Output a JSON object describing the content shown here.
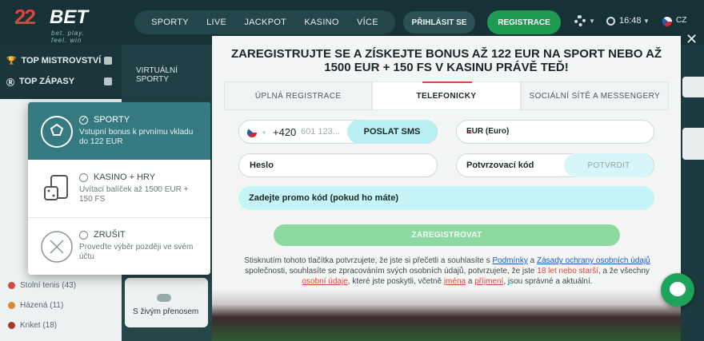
{
  "brand": {
    "logo_num": "22",
    "logo_text": "BET",
    "tagline": "bet. play. feel. win"
  },
  "nav": {
    "items": [
      "SPORTY",
      "LIVE",
      "JACKPOT",
      "KASINO",
      "VÍCE"
    ],
    "login": "PŘIHLÁSIT SE",
    "register": "REGISTRACE",
    "time": "16:48",
    "lang": "CZ"
  },
  "sidebar": {
    "top_items": [
      "TOP MISTROVSTVÍ",
      "TOP ZÁPASY"
    ],
    "virtual": "VIRTUÁLNÍ SPORTY",
    "sports": [
      "Stolní tenis (43)",
      "Házená (11)",
      "Kriket (18)"
    ],
    "live_card": "S živým přenosem"
  },
  "bonus": {
    "options": [
      {
        "title": "SPORTY",
        "desc": "Vstupní bonus k prvnímu vkladu do 122 EUR"
      },
      {
        "title": "KASINO + HRY",
        "desc": "Uvítací balíček až 1500 EUR + 150 FS"
      },
      {
        "title": "ZRUŠIT",
        "desc": "Proveďte výběr později ve svém účtu"
      }
    ]
  },
  "modal": {
    "title": "ZAREGISTRUJTE SE A ZÍSKEJTE BONUS AŽ 122 EUR NA SPORT NEBO AŽ 1500 EUR + 150 FS V KASINU PRÁVĚ TEĎ!",
    "tabs": [
      "ÚPLNÁ REGISTRACE",
      "TELEFONICKY",
      "SOCIÁLNÍ SÍTĚ A MESSENGERY"
    ],
    "phone_code": "+420",
    "phone_placeholder": "601 123...",
    "sms_button": "POSLAT SMS",
    "currency": "EUR (Euro)",
    "password_label": "Heslo",
    "code_label": "Potvrzovací kód",
    "verify_button": "POTVRDIT",
    "promo_label": "Zadejte promo kód (pokud ho máte)",
    "submit": "ZAREGISTROVAT",
    "terms": {
      "p1": "Stisknutím tohoto tlačítka potvrzujete, že jste si přečetli a souhlasíte s ",
      "l1": "Podmínky",
      "p2": " a ",
      "l2": "Zásady ochrany osobních údajů",
      "p3": " společnosti, souhlasíte se zpracováním svých osobních údajů, potvrzujete, že jste ",
      "r1": "18 let nebo starší",
      "p4": ", a že všechny ",
      "r2": "osobní údaje",
      "p5": ", které jste poskytli, včetně ",
      "r3": "jména",
      "p6": " a ",
      "r4": "příjmení",
      "p7": ", jsou správné a aktuální."
    }
  },
  "colors": {
    "accent_green": "#1f9a52",
    "selected_teal": "#357a80",
    "promo_cyan": "#c5f5f7",
    "link_blue": "#1d5cc4",
    "warn_red": "#e0443b"
  }
}
